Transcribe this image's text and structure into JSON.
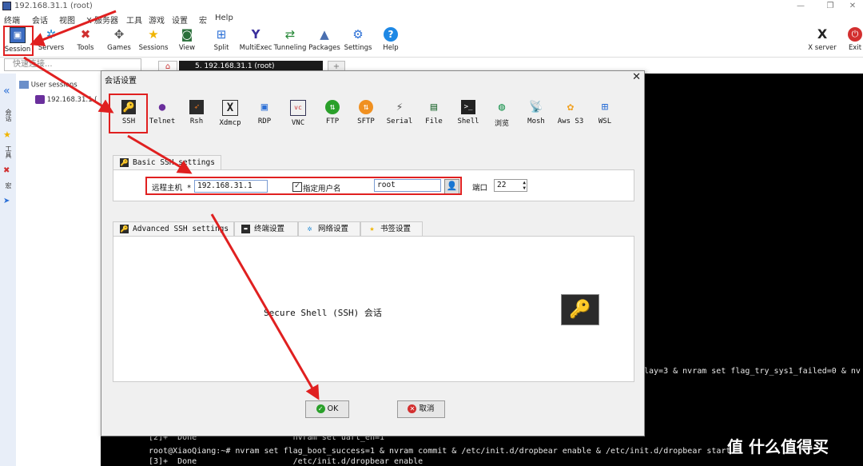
{
  "window": {
    "title": "192.168.31.1 (root)"
  },
  "menu": [
    "终端",
    "会话",
    "视图",
    "X 服务器",
    "工具",
    "游戏",
    "设置",
    "宏",
    "Help"
  ],
  "toolbar": [
    {
      "label": "Session",
      "icon": "session-icon"
    },
    {
      "label": "Servers",
      "icon": "servers-icon"
    },
    {
      "label": "Tools",
      "icon": "tools-icon"
    },
    {
      "label": "Games",
      "icon": "games-icon"
    },
    {
      "label": "Sessions",
      "icon": "star-icon"
    },
    {
      "label": "View",
      "icon": "view-icon"
    },
    {
      "label": "Split",
      "icon": "split-icon"
    },
    {
      "label": "MultiExec",
      "icon": "multiexec-icon"
    },
    {
      "label": "Tunneling",
      "icon": "tunneling-icon"
    },
    {
      "label": "Packages",
      "icon": "packages-icon"
    },
    {
      "label": "Settings",
      "icon": "settings-icon"
    },
    {
      "label": "Help",
      "icon": "help-icon"
    }
  ],
  "toolbar_right": [
    {
      "label": "X server",
      "icon": "x-server-icon"
    },
    {
      "label": "Exit",
      "icon": "exit-icon"
    }
  ],
  "quick_connect": {
    "placeholder": "快速连接..."
  },
  "top_tab": {
    "label": "5. 192.168.31.1 (root)"
  },
  "sidebar": {
    "root_label": "User sessions",
    "session_label": "192.168.31.1 (",
    "vertical_labels": [
      "会话",
      "工具",
      "宏"
    ]
  },
  "terminal": {
    "lines": [
      "[2]+  Done                    nvram set uart_en=1",
      "root@XiaoQiang:~# nvram set flag_boot_success=1 & nvram commit & /etc/init.d/dropbear enable & /etc/init.d/dropbear start",
      "[3]+  Done                    /etc/init.d/dropbear enable"
    ],
    "right_fragment": "lay=3 & nvram set flag_try_sys1_failed=0 & nv"
  },
  "dialog": {
    "title": "会话设置",
    "protocols": [
      "SSH",
      "Telnet",
      "Rsh",
      "Xdmcp",
      "RDP",
      "VNC",
      "FTP",
      "SFTP",
      "Serial",
      "File",
      "Shell",
      "浏览",
      "Mosh",
      "Aws S3",
      "WSL"
    ],
    "basic_tab": "Basic SSH settings",
    "remote_host_label": "远程主机 *",
    "remote_host_value": "192.168.31.1",
    "specify_user_label": "指定用户名",
    "specify_user_checked": true,
    "username_value": "root",
    "port_label": "端口",
    "port_value": "22",
    "subtabs": [
      "Advanced SSH settings",
      "终端设置",
      "网络设置",
      "书签设置"
    ],
    "description": "Secure Shell (SSH) 会话",
    "ok_label": "OK",
    "cancel_label": "取消"
  },
  "watermark": "值 什么值得买",
  "colors": {
    "accent": "#e02020",
    "terminal_bg": "#000000",
    "dialog_bg": "#f0f0f0"
  }
}
